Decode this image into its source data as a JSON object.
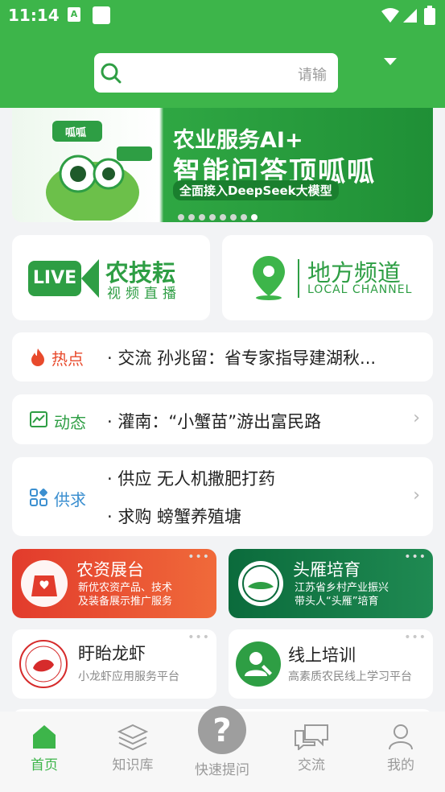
{
  "status_bar": {
    "time": "11:14",
    "notif_icon_letter": "A"
  },
  "search": {
    "placeholder": "请输"
  },
  "banner": {
    "line1": "农业服务AI+",
    "line2": "智能问答顶呱呱",
    "line3": "全面接入DeepSeek大模型",
    "badge": "呱呱",
    "dots_total": 8,
    "dots_active_index": 7
  },
  "live_card": {
    "badge": "LIVE",
    "title": "农技耘",
    "subtitle": "视频直播"
  },
  "local_card": {
    "title": "地方频道",
    "subtitle": "LOCAL CHANNEL"
  },
  "hot": {
    "label": "热点",
    "text": "· 交流 孙兆留：省专家指导建湖秋..."
  },
  "news": {
    "label": "动态",
    "text": "· 灌南：“小蟹苗”游出富民路"
  },
  "supply": {
    "label": "供求",
    "items": [
      "· 供应 无人机撒肥打药",
      "· 求购 螃蟹养殖塘"
    ]
  },
  "tiles": {
    "expo": {
      "title": "农资展台",
      "desc1": "新优农资产品、技术",
      "desc2": "及装备展示推广服务"
    },
    "leader": {
      "title": "头雁培育",
      "desc1": "江苏省乡村产业振兴",
      "desc2": "带头人“头雁”培育"
    },
    "crayfish": {
      "title": "盱眙龙虾",
      "desc": "小龙虾应用服务平台"
    },
    "training": {
      "title": "线上培训",
      "desc": "高素质农民线上学习平台"
    }
  },
  "tabbar": {
    "home": "首页",
    "knowledge": "知识库",
    "ask": "快速提问",
    "exchange": "交流",
    "mine": "我的"
  },
  "colors": {
    "brand_green": "#3db54a",
    "hot_red": "#e84a2c",
    "text_dark": "#222222",
    "tab_inactive": "#9a9a9a"
  }
}
